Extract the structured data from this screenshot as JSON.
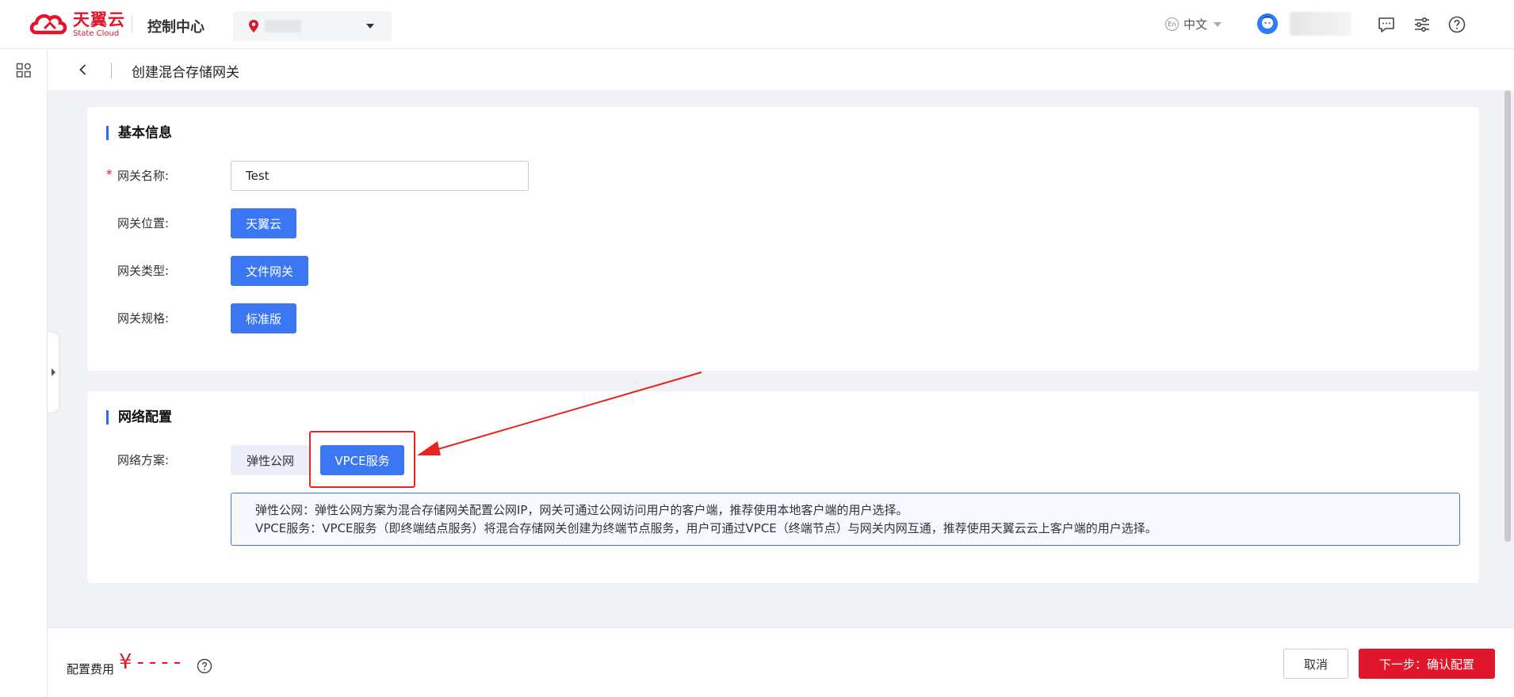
{
  "header": {
    "logo_cn": "天翼云",
    "logo_en": "State Cloud",
    "console_title": "控制中心",
    "language": "中文",
    "lang_badge": "En"
  },
  "subheader": {
    "page_title": "创建混合存储网关"
  },
  "basic_info": {
    "title": "基本信息",
    "name_label": "网关名称:",
    "name_value": "Test",
    "location_label": "网关位置:",
    "location_value": "天翼云",
    "type_label": "网关类型:",
    "type_value": "文件网关",
    "spec_label": "网关规格:",
    "spec_value": "标准版"
  },
  "network": {
    "title": "网络配置",
    "plan_label": "网络方案:",
    "options": [
      "弹性公网",
      "VPCE服务"
    ],
    "selected": "VPCE服务",
    "info_line1": "弹性公网：弹性公网方案为混合存储网关配置公网IP，网关可通过公网访问用户的客户端，推荐使用本地客户端的用户选择。",
    "info_line2": "VPCE服务：VPCE服务（即终端结点服务）将混合存储网关创建为终端节点服务，用户可通过VPCE（终端节点）与网关内网互通，推荐使用天翼云云上客户端的用户选择。"
  },
  "footer": {
    "fee_label": "配置费用",
    "fee_value": "¥----",
    "cancel_label": "取消",
    "next_label": "下一步：确认配置"
  },
  "colors": {
    "brand_red": "#e0162b",
    "primary_blue": "#3b77f3",
    "annotation_red": "#e8241f"
  }
}
